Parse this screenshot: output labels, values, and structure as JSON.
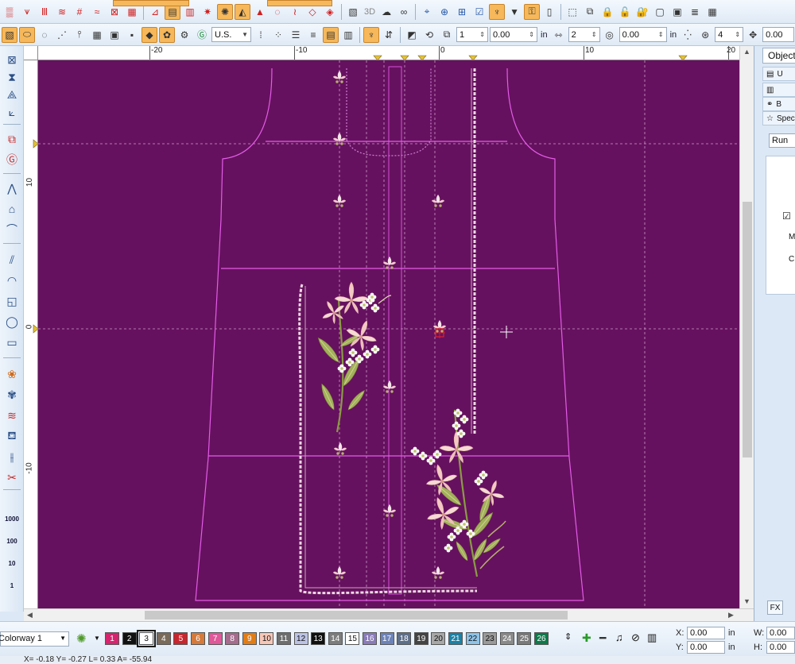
{
  "toolbar1": {
    "label_3d": "3D"
  },
  "toolbar2": {
    "units_value": "U.S.",
    "field_a": "1",
    "field_b": "0.00",
    "unit_in_1": "in",
    "field_c": "2",
    "field_d": "0.00",
    "unit_in_2": "in",
    "field_e": "4",
    "field_f": "0.00"
  },
  "ruler": {
    "h_labels": [
      "-20",
      "-10",
      "0",
      "10",
      "20"
    ],
    "v_labels": [
      "10",
      "0",
      "-10"
    ]
  },
  "left_toolbox": {
    "scale_labels": [
      "1000",
      "100",
      "10",
      "1"
    ]
  },
  "object_panel": {
    "title": "Objects",
    "items": [
      {
        "label": "U"
      },
      {
        "label": ""
      },
      {
        "label": "B"
      },
      {
        "label": "Spec"
      }
    ],
    "stitch_type": "Run",
    "labels": [
      "M",
      "C"
    ],
    "fx_label": "FX"
  },
  "bottom": {
    "colorway": "Colorway 1",
    "swatches": [
      {
        "n": "1",
        "color": "#d6246e"
      },
      {
        "n": "2",
        "color": "#111111"
      },
      {
        "n": "3",
        "color": "#ffffff"
      },
      {
        "n": "4",
        "color": "#7a6a5a"
      },
      {
        "n": "5",
        "color": "#c8262e"
      },
      {
        "n": "6",
        "color": "#d57a3a"
      },
      {
        "n": "7",
        "color": "#e0589a"
      },
      {
        "n": "8",
        "color": "#a56c8e"
      },
      {
        "n": "9",
        "color": "#e27d16"
      },
      {
        "n": "10",
        "color": "#f7c7b8"
      },
      {
        "n": "11",
        "color": "#6e6e6e"
      },
      {
        "n": "12",
        "color": "#bcc3e4"
      },
      {
        "n": "13",
        "color": "#101010"
      },
      {
        "n": "14",
        "color": "#7d7d7d"
      },
      {
        "n": "15",
        "color": "#ffffff"
      },
      {
        "n": "16",
        "color": "#8a7bb8"
      },
      {
        "n": "17",
        "color": "#6d83b8"
      },
      {
        "n": "18",
        "color": "#5e6f8a"
      },
      {
        "n": "19",
        "color": "#444444"
      },
      {
        "n": "20",
        "color": "#a8a8a8"
      },
      {
        "n": "21",
        "color": "#1b82a6"
      },
      {
        "n": "22",
        "color": "#8fc3e8"
      },
      {
        "n": "23",
        "color": "#9a9a9a"
      },
      {
        "n": "24",
        "color": "#8a8a8a"
      },
      {
        "n": "25",
        "color": "#7a7a7a"
      },
      {
        "n": "26",
        "color": "#0e7a4a"
      }
    ],
    "x_label": "X:",
    "x_value": "0.00",
    "y_label": "Y:",
    "y_value": "0.00",
    "w_label": "W:",
    "w_value": "0.00",
    "h_label": "H:",
    "h_value": "0.00",
    "unit": "in"
  },
  "status": {
    "text": "X= -0.18 Y= -0.27 L= 0.33 A= -55.94"
  },
  "colors": {
    "canvas": "#66115f",
    "outline": "#e35ce8",
    "border_stitch": "#f0d9e4",
    "leaf": "#a3b05a",
    "petal": "#f3c9c3"
  }
}
